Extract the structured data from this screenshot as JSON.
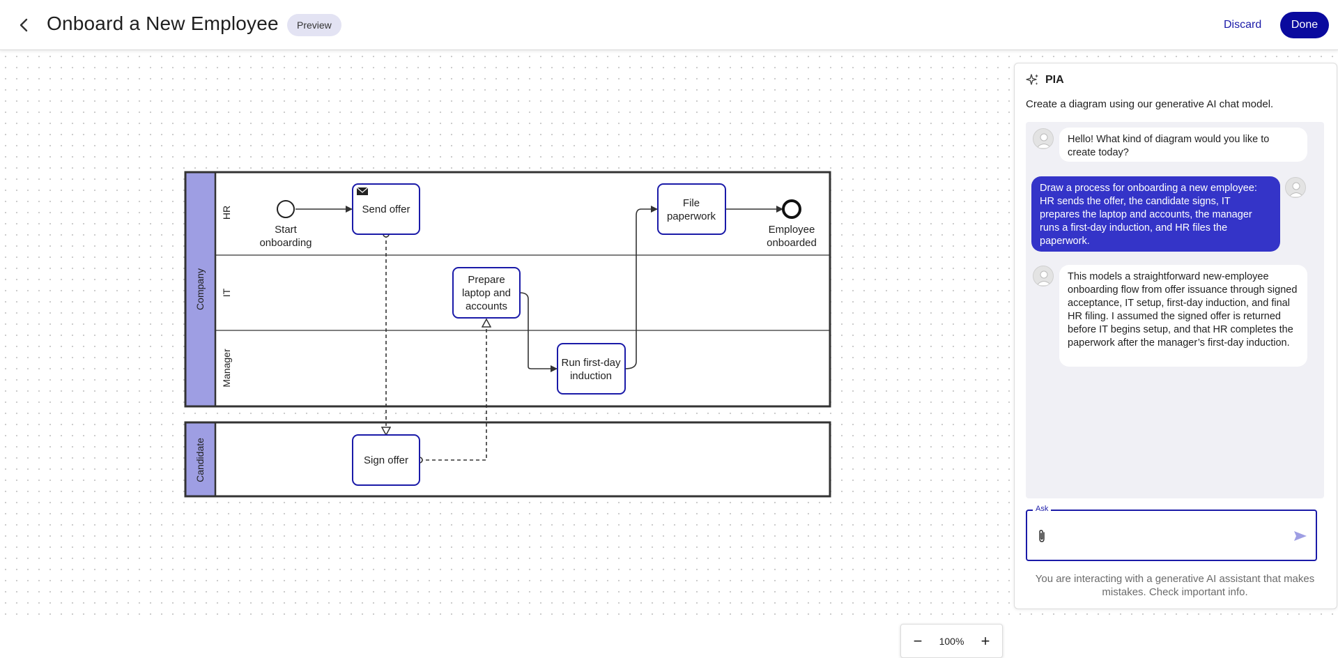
{
  "header": {
    "title": "Onboard a New Employee",
    "badge": "Preview",
    "discard_label": "Discard",
    "done_label": "Done",
    "back_icon": "chevron-left-icon"
  },
  "colors": {
    "primary": "#0a0a9e",
    "user_bubble": "#3434c8",
    "lane_header": "#9e9ee3",
    "task_border": "#1a1aa8"
  },
  "diagram": {
    "pools": [
      {
        "name": "Company",
        "lanes": [
          "HR",
          "IT",
          "Manager"
        ]
      },
      {
        "name": "Candidate",
        "lanes": []
      }
    ],
    "events": {
      "start": "Start onboarding",
      "start_lines": [
        "Start",
        "onboarding"
      ],
      "end": "Employee onboarded",
      "end_lines": [
        "Employee",
        "onboarded"
      ]
    },
    "tasks": {
      "send_offer": "Send offer",
      "file_paperwork": [
        "File",
        "paperwork"
      ],
      "prepare_laptop": [
        "Prepare",
        "laptop and",
        "accounts"
      ],
      "run_induction": [
        "Run first-day",
        "induction"
      ],
      "sign_offer": "Sign offer"
    }
  },
  "assistant": {
    "name": "PIA",
    "icon": "sparkle-icon",
    "subtitle": "Create a diagram using our generative AI chat model.",
    "messages": [
      {
        "role": "assistant",
        "text": "Hello! What kind of diagram would you like to create today?"
      },
      {
        "role": "user",
        "text": "Draw a process for onboarding a new employee: HR sends the offer, the candidate signs, IT prepares the laptop and accounts, the manager runs a first-day induction, and HR files the paperwork."
      },
      {
        "role": "assistant",
        "text": "This models a straightforward new-employee onboarding flow from offer issuance through signed acceptance, IT setup, first-day induction, and final HR filing. I assumed the signed offer is returned before IT begins setup, and that HR completes the paperwork after the manager’s first-day induction."
      }
    ],
    "input_label": "Ask",
    "input_value": "",
    "disclaimer": "You are interacting with a generative AI assistant that makes mistakes. Check important info."
  },
  "zoom": {
    "minus_label": "−",
    "value": "100%",
    "plus_label": "+"
  }
}
